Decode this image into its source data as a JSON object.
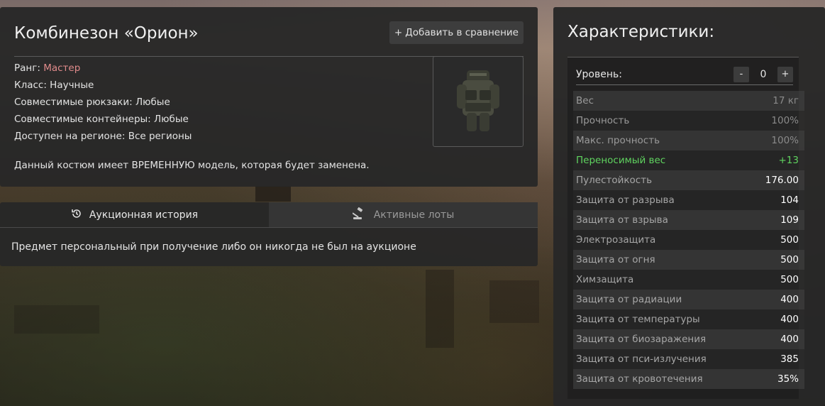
{
  "item": {
    "title": "Комбинезон «Орион»",
    "compare_button": "Добавить в сравнение",
    "compare_icon": "+",
    "rank_label": "Ранг: ",
    "rank_value": "Мастер",
    "rank_color": "#e08b8b",
    "class_line": "Класс: Научные",
    "backpacks_line": "Совместимые рюкзаки: Любые",
    "containers_line": "Совместимые контейнеры: Любые",
    "region_line": "Доступен на регионе: Все регионы",
    "description": "Данный костюм имеет ВРЕМЕННУЮ модель, которая будет заменена."
  },
  "auction": {
    "tabs": [
      {
        "label": "Аукционная история",
        "icon": "history-icon",
        "active": true
      },
      {
        "label": "Активные лоты",
        "icon": "gavel-icon",
        "active": false
      }
    ],
    "message": "Предмет персональный при получение либо он никогда не был на аукционе"
  },
  "stats": {
    "title": "Характеристики:",
    "level_label": "Уровень:",
    "level_minus": "-",
    "level_value": "0",
    "level_plus": "+",
    "rows": [
      {
        "name": "Вес",
        "value": "17 кг",
        "style": "dim"
      },
      {
        "name": "Прочность",
        "value": "100%",
        "style": "dim"
      },
      {
        "name": "Макс. прочность",
        "value": "100%",
        "style": "dim"
      },
      {
        "name": "Переносимый вес",
        "value": "+13",
        "style": "green"
      },
      {
        "name": "Пулестойкость",
        "value": "176.00",
        "style": "bright"
      },
      {
        "name": "Защита от разрыва",
        "value": "104",
        "style": "bright"
      },
      {
        "name": "Защита от взрыва",
        "value": "109",
        "style": "bright"
      },
      {
        "name": "Электрозащита",
        "value": "500",
        "style": "bright"
      },
      {
        "name": "Защита от огня",
        "value": "500",
        "style": "bright"
      },
      {
        "name": "Химзащита",
        "value": "500",
        "style": "bright"
      },
      {
        "name": "Защита от радиации",
        "value": "400",
        "style": "bright"
      },
      {
        "name": "Защита от температуры",
        "value": "400",
        "style": "bright"
      },
      {
        "name": "Защита от биозаражения",
        "value": "400",
        "style": "bright"
      },
      {
        "name": "Защита от пси-излучения",
        "value": "385",
        "style": "bright"
      },
      {
        "name": "Защита от кровотечения",
        "value": "35%",
        "style": "bright"
      }
    ],
    "green_color": "#5fd35f"
  }
}
